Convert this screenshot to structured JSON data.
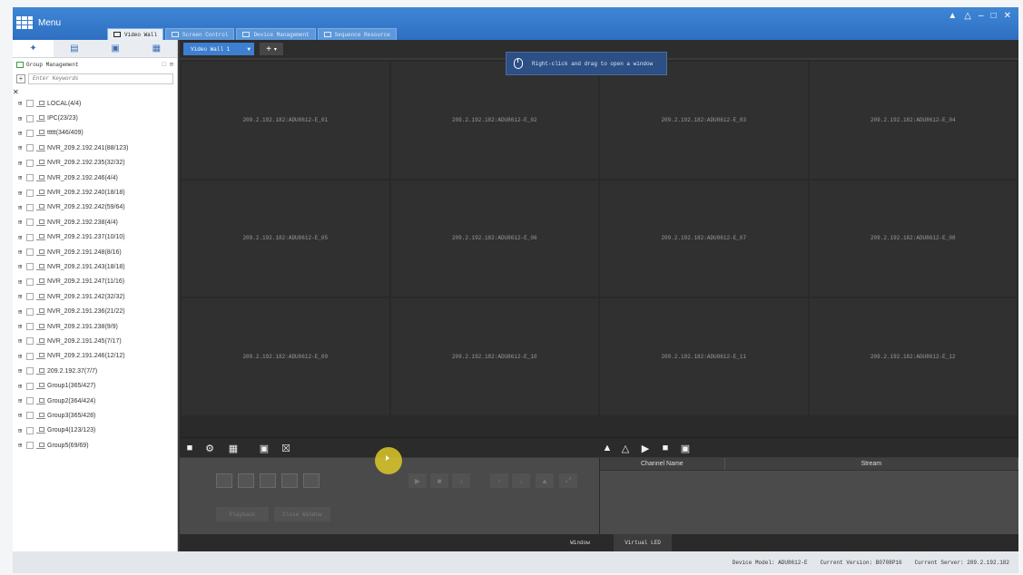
{
  "titlebar": {
    "menu_label": "Menu",
    "controls": [
      "▲",
      "△",
      "–",
      "□",
      "✕"
    ]
  },
  "tabs": [
    {
      "label": "Video Wall",
      "active": true
    },
    {
      "label": "Screen Control",
      "active": false
    },
    {
      "label": "Device Management",
      "active": false
    },
    {
      "label": "Sequence Resource",
      "active": false
    }
  ],
  "left_panel": {
    "group_title": "Group Management",
    "search_placeholder": "Enter Keywords",
    "tree": [
      "LOCAL(4/4)",
      "IPC(23/23)",
      "ttttt(346/409)",
      "NVR_209.2.192.241(88/123)",
      "NVR_209.2.192.235(32/32)",
      "NVR_209.2.192.246(4/4)",
      "NVR_209.2.192.240(18/18)",
      "NVR_209.2.192.242(59/64)",
      "NVR_209.2.192.238(4/4)",
      "NVR_209.2.191.237(10/10)",
      "NVR_209.2.191.248(8/16)",
      "NVR_209.2.191.243(18/18)",
      "NVR_209.2.191.247(11/16)",
      "NVR_209.2.191.242(32/32)",
      "NVR_209.2.191.236(21/22)",
      "NVR_209.2.191.238(9/9)",
      "NVR_209.2.191.245(7/17)",
      "NVR_209.2.191.246(12/12)",
      "209.2.192.37(7/7)",
      "Group1(365/427)",
      "Group2(364/424)",
      "Group3(365/428)",
      "Group4(123/123)",
      "Group5(69/69)"
    ]
  },
  "wall": {
    "tab_label": "Video Wall 1",
    "hint": "Right-click and drag to open a window",
    "screens": [
      "209.2.192.182:ADU8612-E_01",
      "209.2.192.182:ADU8612-E_02",
      "209.2.192.182:ADU8612-E_03",
      "209.2.192.182:ADU8612-E_04",
      "209.2.192.182:ADU8612-E_05",
      "209.2.192.182:ADU8612-E_06",
      "209.2.192.182:ADU8612-E_07",
      "209.2.192.182:ADU8612-E_08",
      "209.2.192.182:ADU8612-E_09",
      "209.2.192.182:ADU8612-E_10",
      "209.2.192.182:ADU8612-E_11",
      "209.2.192.182:ADU8612-E_12"
    ]
  },
  "controls": {
    "playback_label": "Playback",
    "close_window_label": "Close Window"
  },
  "list": {
    "col_channel": "Channel Name",
    "col_stream": "Stream"
  },
  "bottom_tabs": {
    "window": "Window",
    "virtual_led": "Virtual LED"
  },
  "status": {
    "device_model": "Device Model: ADU8612-E",
    "current_version": "Current Version: B0708P16",
    "current_server": "Current Server: 209.2.192.182"
  }
}
